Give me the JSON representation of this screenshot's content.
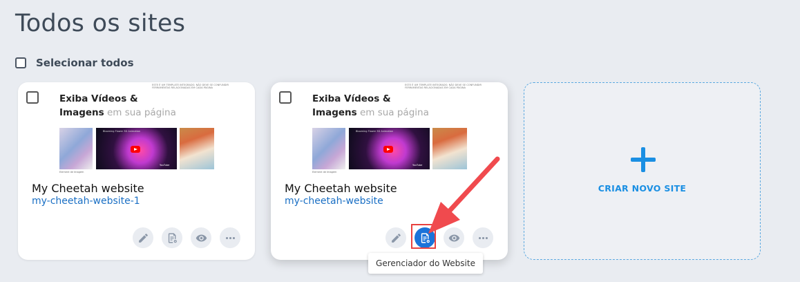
{
  "page": {
    "title": "Todos os sites",
    "select_all_label": "Selecionar todos"
  },
  "thumbnail": {
    "title_line1": "Exiba Vídeos &",
    "title_line2_bold": "Imagens",
    "title_line2_rest": " em sua página",
    "tiny_text": "Este é um template integrado. Não deve se confundir ferramentas relacionadas em cada página",
    "video_caption": "Blooming Flower 3D Animation",
    "yt_label": "YouTube",
    "image_caption": "Element de Imagem"
  },
  "sites": [
    {
      "name": "My Cheetah website",
      "slug": "my-cheetah-website-1"
    },
    {
      "name": "My Cheetah website",
      "slug": "my-cheetah-website"
    }
  ],
  "actions": [
    {
      "icon": "pencil-icon",
      "label": "Editar"
    },
    {
      "icon": "website-manager-icon",
      "label": "Gerenciador do Website"
    },
    {
      "icon": "eye-icon",
      "label": "Visualizar"
    },
    {
      "icon": "more-icon",
      "label": "Mais"
    }
  ],
  "new_site": {
    "label": "CRIAR NOVO SITE"
  },
  "tooltip": {
    "text": "Gerenciador do Website"
  },
  "colors": {
    "accent": "#1a73d9",
    "plus": "#1a8fe3",
    "highlight": "#e8413f",
    "link": "#1a6fc4"
  }
}
